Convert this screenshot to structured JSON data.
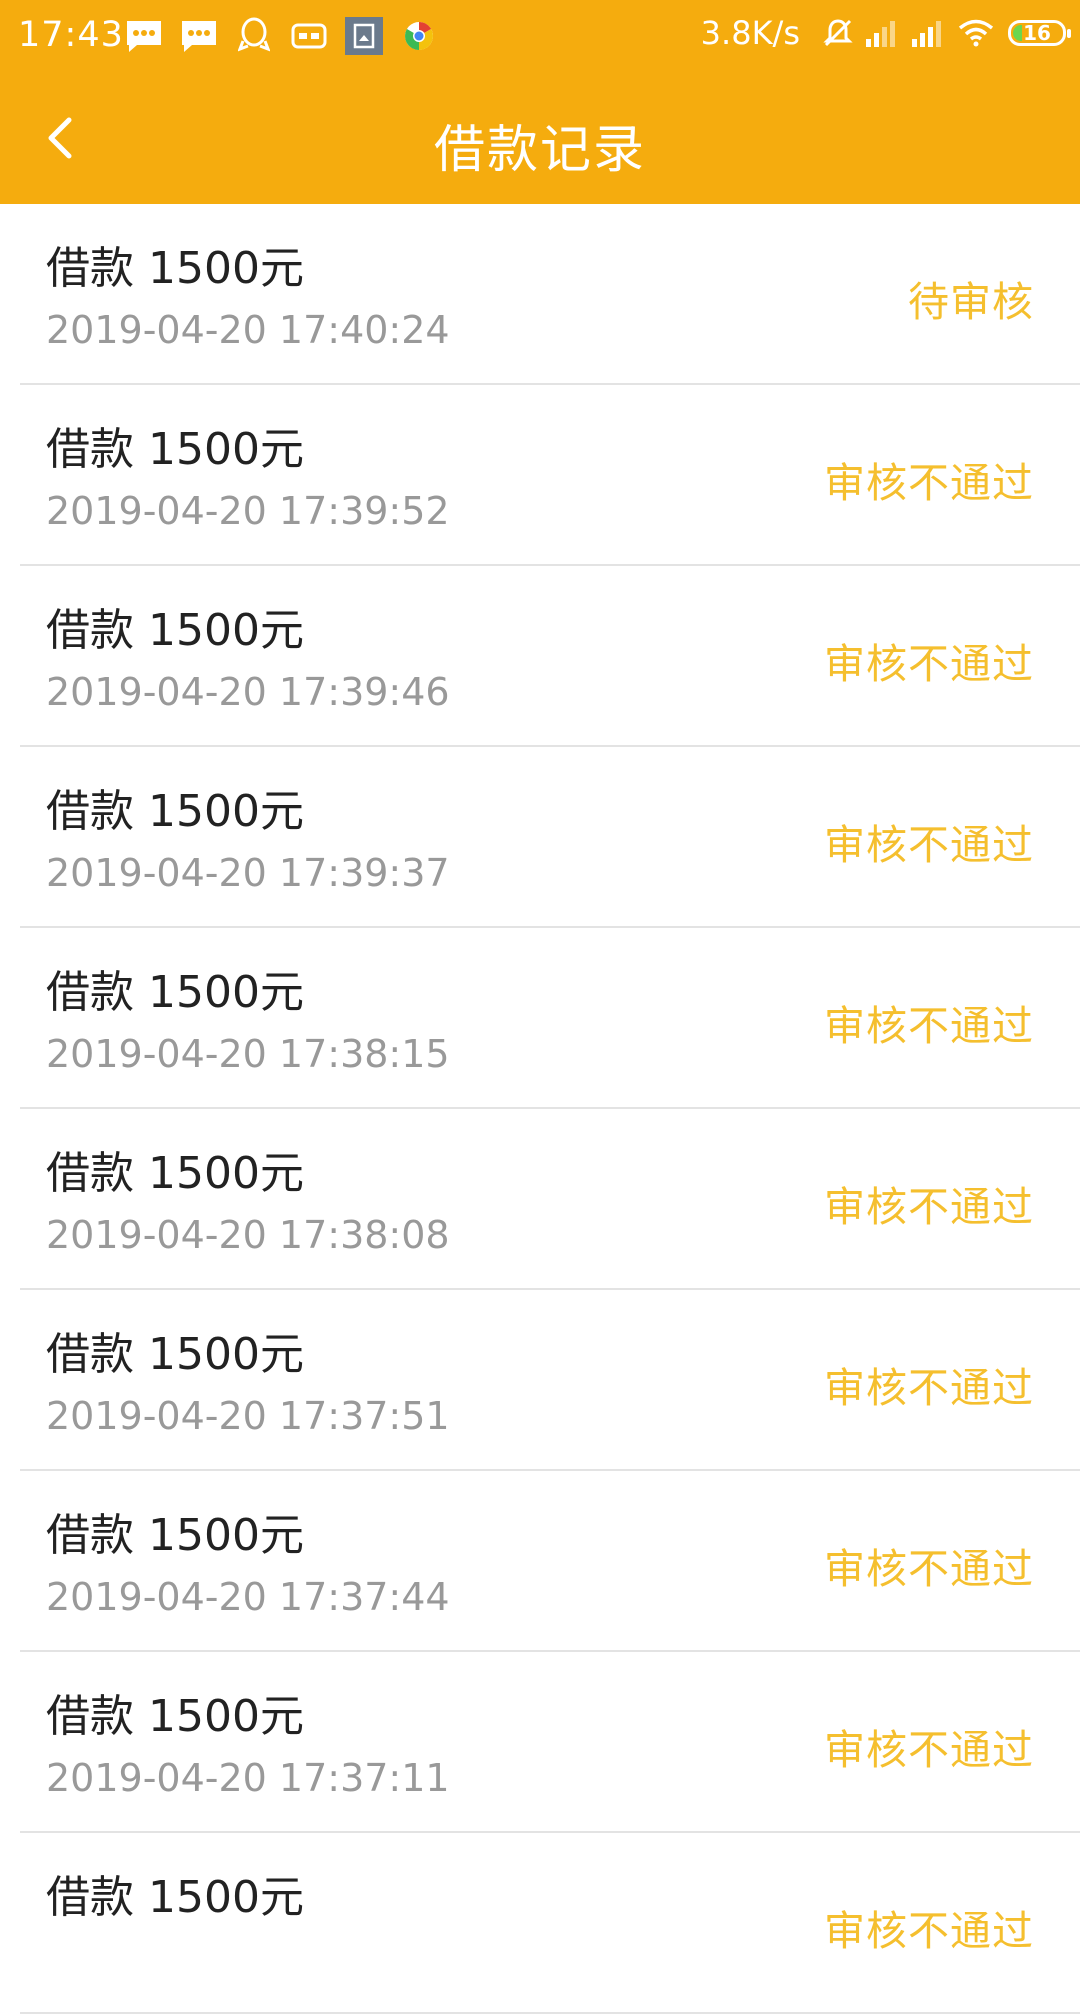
{
  "status_bar": {
    "time": "17:43",
    "net_speed": "3.8K/s",
    "battery": "16",
    "notification_icons": [
      "message-icon",
      "message-icon",
      "qq-icon",
      "vr-icon",
      "gallery-icon",
      "chrome-icon"
    ],
    "system_icons": [
      "mute-icon",
      "signal-icon",
      "signal-icon",
      "wifi-icon",
      "battery-icon"
    ]
  },
  "header": {
    "title": "借款记录",
    "back_icon": "back-arrow-icon"
  },
  "colors": {
    "accent": "#f5ac0e",
    "status_text": "#f5bf2e",
    "title_text": "#222222",
    "time_text": "#999999",
    "divider": "#e3e3e3"
  },
  "records": [
    {
      "title": "借款 1500元",
      "time": "2019-04-20 17:40:24",
      "status": "待审核"
    },
    {
      "title": "借款 1500元",
      "time": "2019-04-20 17:39:52",
      "status": "审核不通过"
    },
    {
      "title": "借款 1500元",
      "time": "2019-04-20 17:39:46",
      "status": "审核不通过"
    },
    {
      "title": "借款 1500元",
      "time": "2019-04-20 17:39:37",
      "status": "审核不通过"
    },
    {
      "title": "借款 1500元",
      "time": "2019-04-20 17:38:15",
      "status": "审核不通过"
    },
    {
      "title": "借款 1500元",
      "time": "2019-04-20 17:38:08",
      "status": "审核不通过"
    },
    {
      "title": "借款 1500元",
      "time": "2019-04-20 17:37:51",
      "status": "审核不通过"
    },
    {
      "title": "借款 1500元",
      "time": "2019-04-20 17:37:44",
      "status": "审核不通过"
    },
    {
      "title": "借款 1500元",
      "time": "2019-04-20 17:37:11",
      "status": "审核不通过"
    },
    {
      "title": "借款 1500元",
      "time": "",
      "status": "审核不通过"
    }
  ]
}
